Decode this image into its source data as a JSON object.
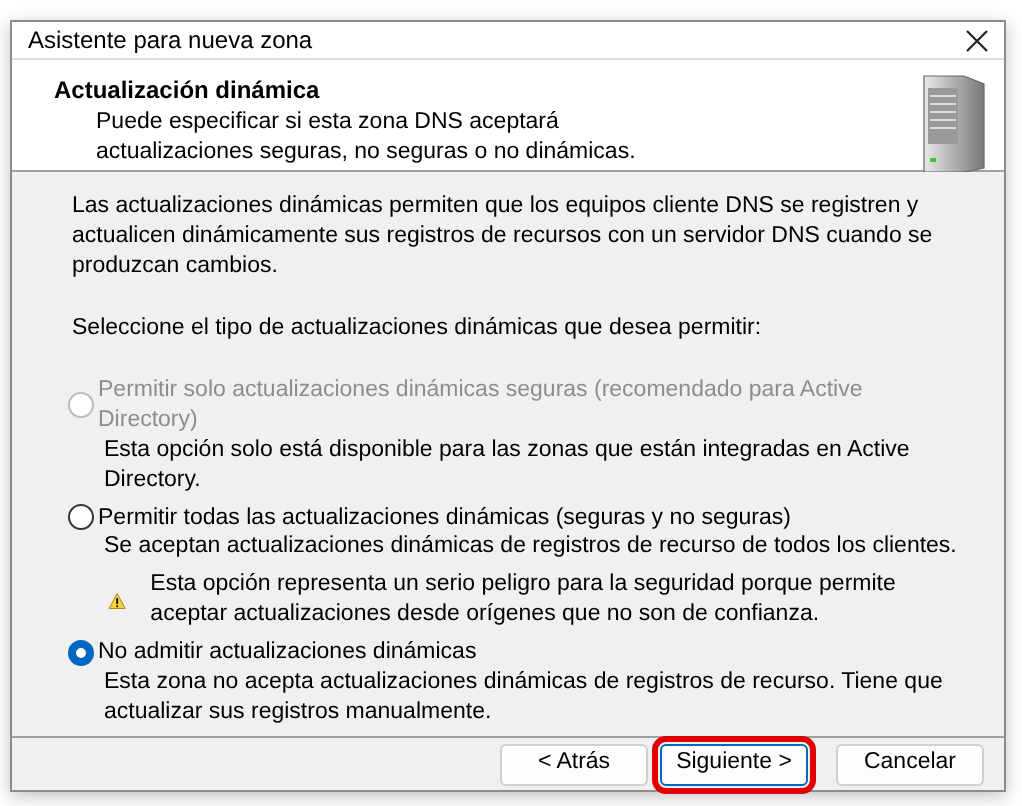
{
  "window": {
    "title": "Asistente para nueva zona"
  },
  "header": {
    "title": "Actualización dinámica",
    "subtitle": "Puede especificar si esta zona DNS aceptará actualizaciones seguras, no seguras o no dinámicas."
  },
  "intro": "Las actualizaciones dinámicas permiten que los equipos cliente DNS se registren y actualicen dinámicamente sus registros de recursos con un servidor DNS cuando se produzcan cambios.",
  "prompt": "Seleccione el tipo de actualizaciones dinámicas que desea permitir:",
  "options": [
    {
      "label": "Permitir solo actualizaciones dinámicas seguras (recomendado para Active Directory)",
      "description": "Esta opción solo está disponible para las zonas que están integradas en Active Directory.",
      "selected": false,
      "disabled": true
    },
    {
      "label": "Permitir todas las actualizaciones dinámicas (seguras y no seguras)",
      "description": "Se aceptan actualizaciones dinámicas de registros de recurso de todos los clientes.",
      "warning": "Esta opción representa un serio peligro para la seguridad porque permite aceptar actualizaciones desde orígenes que no son de confianza.",
      "selected": false,
      "disabled": false
    },
    {
      "label": "No admitir actualizaciones dinámicas",
      "description": "Esta zona no acepta actualizaciones dinámicas de registros de recurso. Tiene que actualizar sus registros manualmente.",
      "selected": true,
      "disabled": false
    }
  ],
  "buttons": [
    {
      "label": "< Atrás",
      "highlighted": false
    },
    {
      "label": "Siguiente >",
      "highlighted": true
    },
    {
      "label": "Cancelar",
      "highlighted": false
    }
  ]
}
